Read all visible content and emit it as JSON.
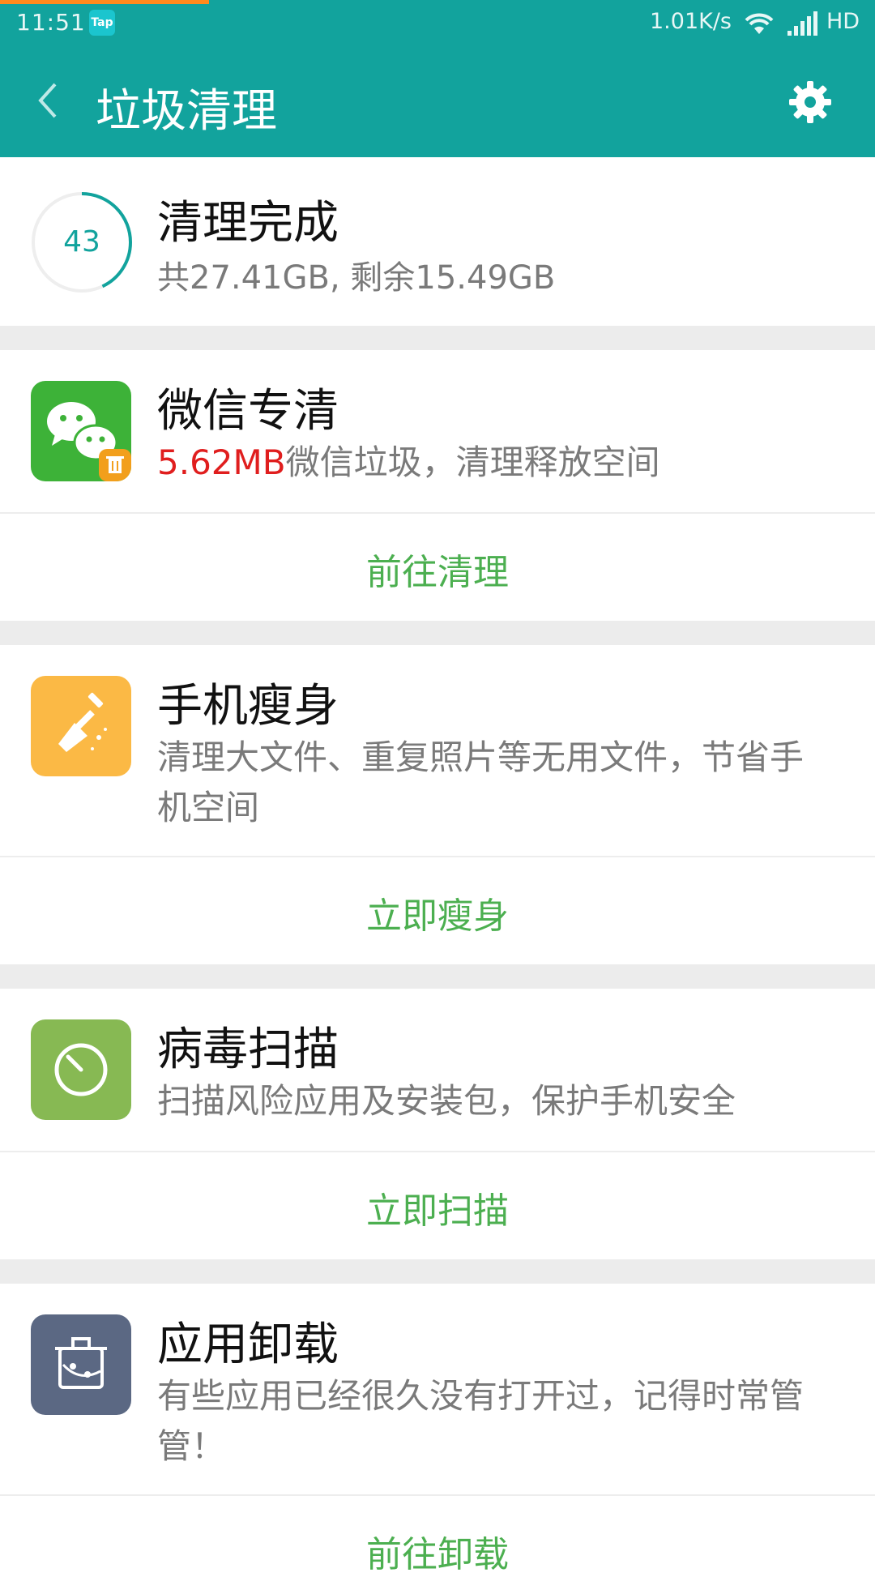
{
  "status_bar": {
    "time": "11:51",
    "tap_badge": "Tap",
    "speed": "1.01K/s",
    "network_label": "HD",
    "icons": [
      "wifi-icon",
      "signal-icon"
    ]
  },
  "app_bar": {
    "title": "垃圾清理",
    "icons": [
      "back-icon",
      "gear-icon"
    ]
  },
  "summary": {
    "score": "43",
    "title": "清理完成",
    "subtitle": "共27.41GB, 剩余15.49GB",
    "ring_fraction": 0.43
  },
  "cards": [
    {
      "title": "微信专清",
      "desc_highlight": "5.62MB",
      "desc": "微信垃圾，清理释放空间",
      "action": "前往清理",
      "icon": "wechat-icon",
      "icon_color": "#3db238"
    },
    {
      "title": "手机瘦身",
      "desc": "清理大文件、重复照片等无用文件，节省手机空间",
      "action": "立即瘦身",
      "icon": "shovel-icon",
      "icon_color": "#fbb945"
    },
    {
      "title": "病毒扫描",
      "desc": "扫描风险应用及安装包，保护手机安全",
      "action": "立即扫描",
      "icon": "scan-icon",
      "icon_color": "#87b953"
    },
    {
      "title": "应用卸载",
      "desc": "有些应用已经很久没有打开过，记得时常管管！",
      "action": "前往卸载",
      "icon": "uninstall-icon",
      "icon_color": "#5b6883"
    }
  ],
  "colors": {
    "accent": "#12a39d",
    "action_green": "#4caf50",
    "highlight_red": "#e01e1e",
    "top_progress": "#ff8a1d"
  }
}
